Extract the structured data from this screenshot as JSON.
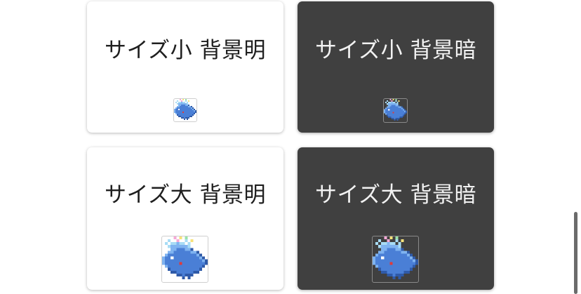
{
  "cards": [
    {
      "title": "サイズ小 背景明",
      "size": "small",
      "theme": "light",
      "icon": "whale-pixel-icon"
    },
    {
      "title": "サイズ小 背景暗",
      "size": "small",
      "theme": "dark",
      "icon": "whale-pixel-icon"
    },
    {
      "title": "サイズ大 背景明",
      "size": "large",
      "theme": "light",
      "icon": "whale-pixel-icon"
    },
    {
      "title": "サイズ大 背景暗",
      "size": "large",
      "theme": "dark",
      "icon": "whale-pixel-icon"
    }
  ],
  "colors": {
    "light_card": "#ffffff",
    "dark_card": "#404040",
    "whale_body": "#4a7fd6",
    "whale_light": "#7fb3f0",
    "whale_dark": "#2f5aa8",
    "spout": "#a8dcf5",
    "accent_red": "#e03a3a"
  }
}
